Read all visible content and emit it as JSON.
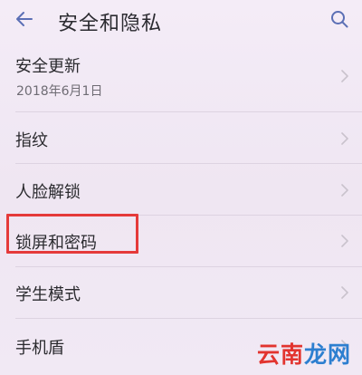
{
  "header": {
    "title": "安全和隐私",
    "back_icon": "back-arrow-icon",
    "search_icon": "search-icon"
  },
  "items": [
    {
      "label": "安全更新",
      "sublabel": "2018年6月1日"
    },
    {
      "label": "指纹"
    },
    {
      "label": "人脸解锁"
    },
    {
      "label": "锁屏和密码"
    },
    {
      "label": "学生模式"
    },
    {
      "label": "手机盾"
    }
  ],
  "highlight": {
    "item": "锁屏和密码",
    "color": "#e53a3a"
  },
  "watermark": {
    "part1": "云南",
    "part2": "龙网",
    "color1": "#e2342f",
    "color2": "#2d7fd0"
  },
  "colors": {
    "accent": "#5b6fb5",
    "background": "#f0e8f3",
    "chevron": "#c9c2cc",
    "divider": "#ddd3e1"
  }
}
